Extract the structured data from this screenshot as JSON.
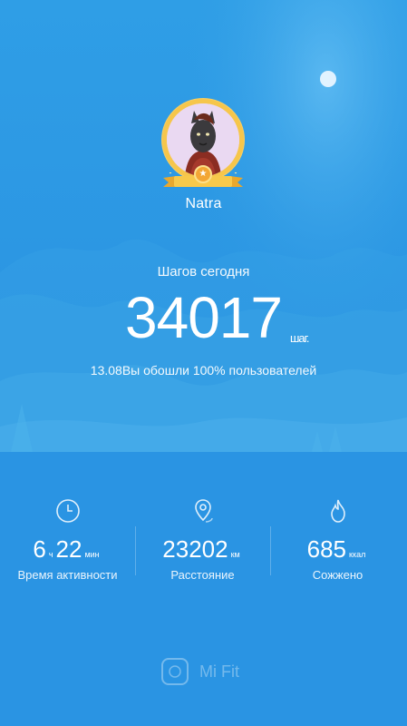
{
  "profile": {
    "name": "Natra"
  },
  "steps": {
    "title": "Шагов сегодня",
    "value": "34017",
    "unit": "шаг.",
    "note": "13.08Вы обошли 100% пользователей"
  },
  "stats": {
    "activity": {
      "hours": "6",
      "hours_unit": "ч",
      "minutes": "22",
      "minutes_unit": "мин",
      "label": "Время активности",
      "icon": "clock-icon"
    },
    "distance": {
      "value": "23202",
      "unit": "км",
      "label": "Расстояние",
      "icon": "location-pin-icon"
    },
    "calories": {
      "value": "685",
      "unit": "ккал",
      "label": "Сожжено",
      "icon": "flame-icon"
    }
  },
  "brand": {
    "name": "Mi Fit",
    "icon": "mi-fit-logo-icon"
  },
  "colors": {
    "background": "#2f9ee6",
    "accent_gold": "#f6c64b",
    "text": "#ffffff"
  }
}
